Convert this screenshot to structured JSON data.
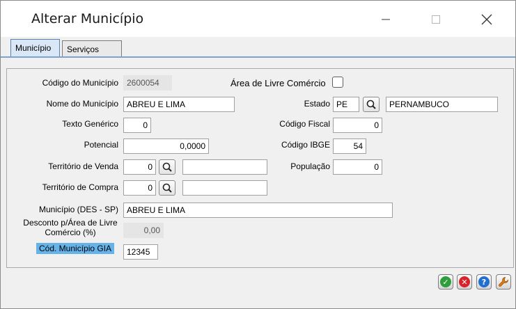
{
  "window": {
    "title": "Alterar Município"
  },
  "tabs": [
    {
      "label": "Município",
      "active": true
    },
    {
      "label": "Serviços",
      "active": false
    }
  ],
  "form": {
    "codigo_municipio": {
      "label": "Código do Município",
      "value": "2600054"
    },
    "area_livre_comercio": {
      "label": "Área de Livre Comércio",
      "checked": false
    },
    "nome_municipio": {
      "label": "Nome do Município",
      "value": "ABREU E LIMA"
    },
    "estado": {
      "label": "Estado",
      "value": "PE",
      "nome": "PERNAMBUCO"
    },
    "texto_generico": {
      "label": "Texto Genérico",
      "value": "0"
    },
    "codigo_fiscal": {
      "label": "Código Fiscal",
      "value": "0"
    },
    "potencial": {
      "label": "Potencial",
      "value": "0,0000"
    },
    "codigo_ibge": {
      "label": "Código IBGE",
      "value": "54"
    },
    "territorio_venda": {
      "label": "Território de Venda",
      "value": "0",
      "descricao": ""
    },
    "populacao": {
      "label": "População",
      "value": "0"
    },
    "territorio_compra": {
      "label": "Território de Compra",
      "value": "0",
      "descricao": ""
    },
    "municipio_des_sp": {
      "label": "Município (DES - SP)",
      "value": "ABREU E LIMA"
    },
    "desconto": {
      "label": "Desconto p/Área de Livre Comércio (%)",
      "value": "0,00"
    },
    "cod_municipio_gia": {
      "label": "Cód. Município GIA",
      "value": "12345"
    }
  },
  "actions": {
    "confirm_icon": "check-icon",
    "cancel_icon": "cancel-icon",
    "help_icon": "help-icon",
    "tools_icon": "wrench-icon"
  },
  "colors": {
    "confirm": "#2e9e3c",
    "cancel": "#d9232b",
    "help": "#1f6fd1",
    "tools": "#e07b10",
    "selected_label": "#66b3ea"
  }
}
